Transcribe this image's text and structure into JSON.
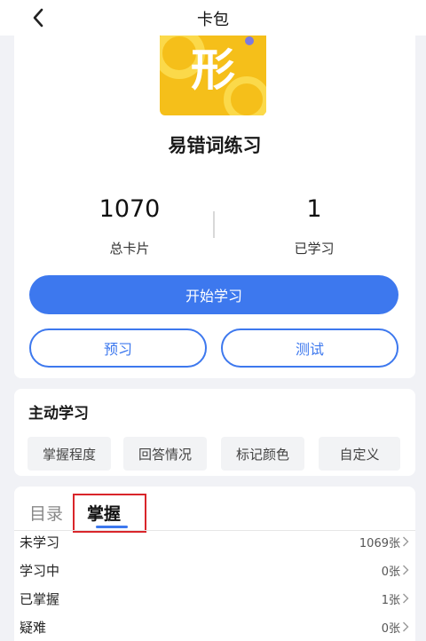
{
  "header": {
    "title": "卡包",
    "back_icon": "chevron-left-icon"
  },
  "deck": {
    "logo_text": "形",
    "logo_color": "#f5bf1a",
    "name": "易错词练习",
    "total_cards": {
      "value": "1070",
      "label": "总卡片"
    },
    "learned": {
      "value": "1",
      "label": "已学习"
    }
  },
  "actions": {
    "start": "开始学习",
    "preview": "预习",
    "test": "测试"
  },
  "active_learning": {
    "title": "主动学习",
    "chips": [
      "掌握程度",
      "回答情况",
      "标记颜色",
      "自定义"
    ]
  },
  "tabs": {
    "catalog": "目录",
    "mastery": "掌握"
  },
  "mastery_rows": [
    {
      "label": "未学习",
      "count": "1069张"
    },
    {
      "label": "学习中",
      "count": "0张"
    },
    {
      "label": "已掌握",
      "count": "1张"
    },
    {
      "label": "疑难",
      "count": "0张"
    }
  ],
  "colors": {
    "accent": "#3d78ee",
    "highlight": "#d9252a"
  }
}
